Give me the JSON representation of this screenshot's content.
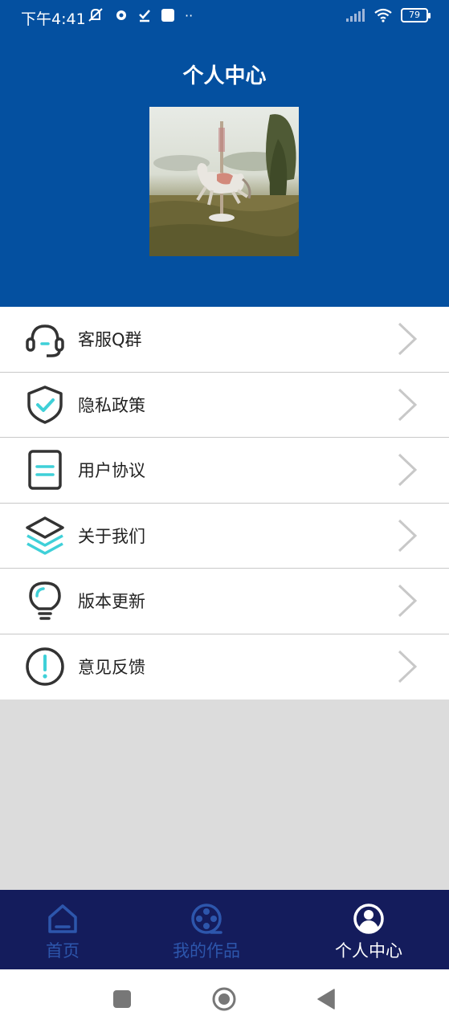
{
  "status_bar": {
    "time": "下午4:41",
    "battery": "79",
    "more_indicator": "··"
  },
  "header": {
    "title": "个人中心"
  },
  "avatar": {
    "alt": "carousel horse in field"
  },
  "menu": {
    "items": [
      {
        "label": "客服Q群",
        "icon": "headset-icon"
      },
      {
        "label": "隐私政策",
        "icon": "shield-check-icon"
      },
      {
        "label": "用户协议",
        "icon": "document-icon"
      },
      {
        "label": "关于我们",
        "icon": "layers-icon"
      },
      {
        "label": "版本更新",
        "icon": "lightbulb-icon"
      },
      {
        "label": "意见反馈",
        "icon": "exclamation-circle-icon"
      }
    ]
  },
  "bottom_nav": {
    "tabs": [
      {
        "label": "首页",
        "icon": "home-icon",
        "active": false
      },
      {
        "label": "我的作品",
        "icon": "film-reel-icon",
        "active": false
      },
      {
        "label": "个人中心",
        "icon": "user-icon",
        "active": true
      }
    ]
  },
  "colors": {
    "header_bg": "#0450a0",
    "nav_bg": "#141c5c",
    "nav_inactive": "#2d56ac",
    "icon_accent": "#3fd0d8",
    "icon_stroke": "#333333"
  }
}
